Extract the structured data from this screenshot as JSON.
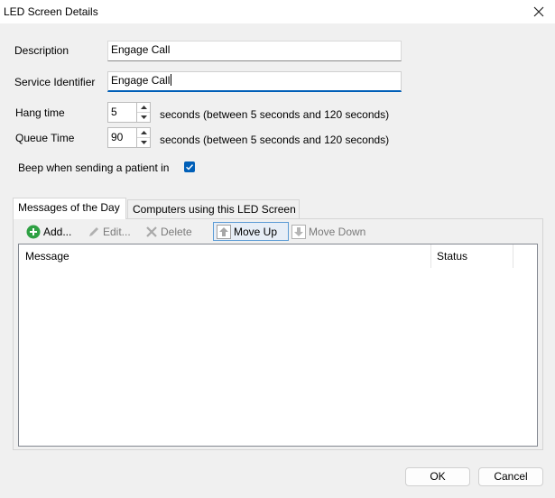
{
  "window": {
    "title": "LED Screen Details"
  },
  "form": {
    "description_label": "Description",
    "description_value": "Engage Call",
    "service_identifier_label": "Service Identifier",
    "service_identifier_value": "Engage Call",
    "hang_time_label": "Hang time",
    "hang_time_value": "5",
    "hang_time_hint": "seconds (between 5 seconds and 120 seconds)",
    "queue_time_label": "Queue Time",
    "queue_time_value": "90",
    "queue_time_hint": "seconds (between 5 seconds and 120 seconds)",
    "beep_label": "Beep when sending a patient in",
    "beep_checked": true
  },
  "tabs": [
    {
      "label": "Messages of the Day",
      "active": true
    },
    {
      "label": "Computers using this LED Screen",
      "active": false
    }
  ],
  "toolbar": {
    "add_label": "Add...",
    "edit_label": "Edit...",
    "delete_label": "Delete",
    "move_up_label": "Move Up",
    "move_down_label": "Move Down"
  },
  "list": {
    "columns": [
      "Message",
      "Status"
    ],
    "rows": []
  },
  "footer": {
    "ok_label": "OK",
    "cancel_label": "Cancel"
  },
  "colors": {
    "accent": "#005fb8",
    "add_icon": "#2ea043",
    "background": "#f0f0f0"
  }
}
